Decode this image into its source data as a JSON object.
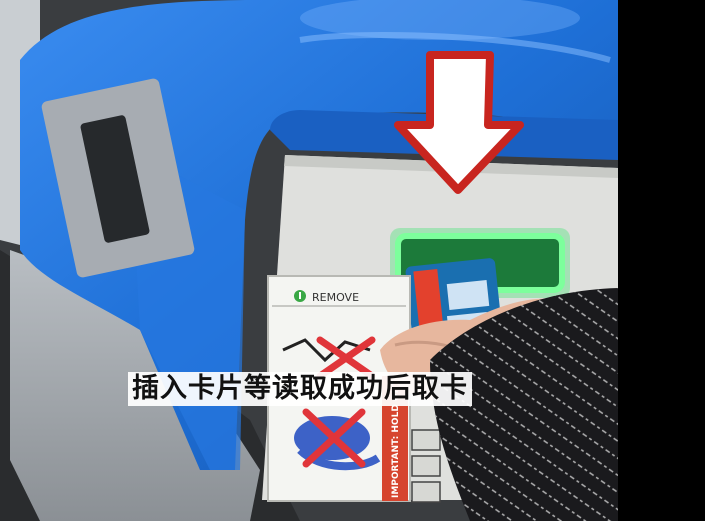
{
  "caption": "插入卡片等读取成功后取卡",
  "sticker": {
    "remove_label": "REMOVE",
    "remove_icon": "info-circle-icon",
    "warning_strip": "IMPORTANT: HOLD ONTO"
  },
  "colors": {
    "gate_blue": "#1e6fd6",
    "arrow_red": "#c8251f",
    "reader_green": "#36e36a",
    "cross_red": "#e0353a",
    "sleeve": "#1a1a1d"
  }
}
